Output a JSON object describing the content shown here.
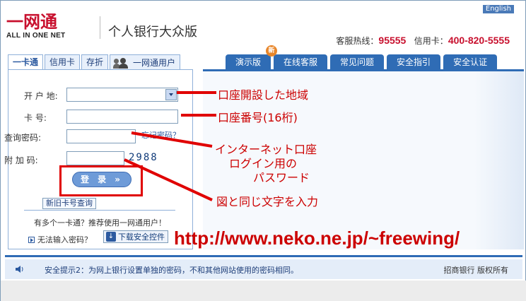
{
  "header": {
    "english_link": "English",
    "logo_cn": "一网通",
    "logo_en": "ALL IN ONE NET",
    "subtitle": "个人银行大众版",
    "hotline_label": "客服热线：",
    "hotline_number": "95555",
    "card_label": "信用卡：",
    "card_number": "400-820-5555"
  },
  "left_tabs": [
    {
      "label": "一卡通",
      "active": true
    },
    {
      "label": "信用卡",
      "active": false
    },
    {
      "label": "存折",
      "active": false
    },
    {
      "label": "一网通用户",
      "active": false,
      "icon": "users-icon"
    }
  ],
  "form": {
    "region_label": "开 户 地:",
    "region_value": "",
    "card_label": "卡     号:",
    "card_value": "",
    "password_label": "查询密码:",
    "password_value": "",
    "forgot_label": "忘记密码？",
    "code_label": "附 加 码:",
    "code_value": "",
    "captcha_text": "2988",
    "login_label": "登 录 »",
    "newold_label": "新旧卡号查询",
    "multi_card_tip": "有多个一卡通？推荐使用一网通用户！",
    "cannot_input_label": "无法输入密码？",
    "download_label": "下载安全控件"
  },
  "right_tabs": [
    {
      "label": "演示版"
    },
    {
      "label": "在线客服"
    },
    {
      "label": "常见问题"
    },
    {
      "label": "安全指引"
    },
    {
      "label": "安全认证"
    }
  ],
  "new_badge": "新",
  "footer": {
    "safety_tip": "安全提示2：为网上银行设置单独的密码，不和其他网站使用的密码相同。",
    "copyright": "招商银行  版权所有"
  },
  "annotations": {
    "region": "口座開設した地域",
    "card": "口座番号(16桁)",
    "password_line1": "インターネット口座",
    "password_line2": "ログイン用の",
    "password_line3": "パスワード",
    "captcha": "図と同じ文字を入力",
    "url": "http://www.neko.ne.jp/~freewing/"
  },
  "colors": {
    "brand_red": "#c8102e",
    "tab_blue": "#2f6cb5",
    "annotation_red": "#e00000"
  }
}
